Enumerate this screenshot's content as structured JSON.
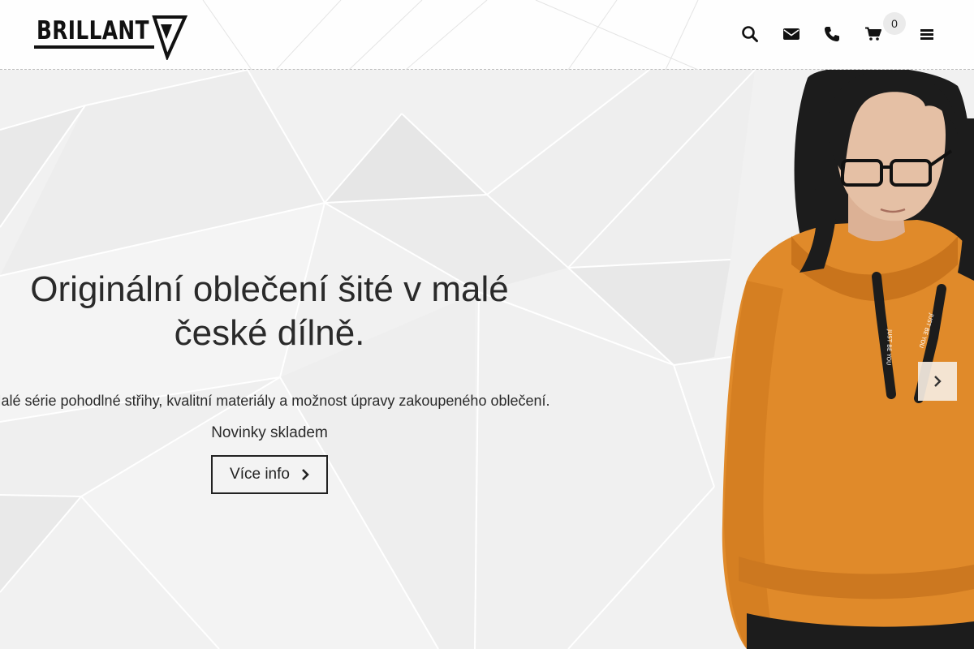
{
  "header": {
    "logo_text": "BRILLANT",
    "icons": {
      "search": "search-icon",
      "mail": "envelope-icon",
      "phone": "phone-icon",
      "cart": "cart-icon",
      "menu": "hamburger-menu-icon"
    },
    "cart_count": "0"
  },
  "hero": {
    "title": "Originální oblečení šité v malé české dílně.",
    "description": "Malé série pohodlné střihy, kvalitní materiály a možnost úpravy zakoupeného oblečení.",
    "subtitle": "Novinky skladem",
    "button_label": "Více info",
    "lanyard_text": "JUST BE YOU"
  },
  "colors": {
    "accent_orange": "#e08a2a",
    "text": "#2a2a2a",
    "background": "#f2f2f2"
  }
}
